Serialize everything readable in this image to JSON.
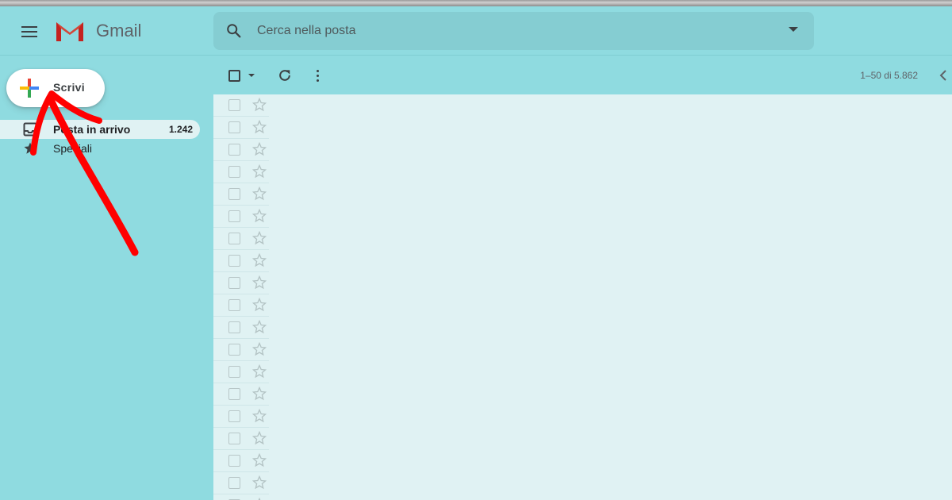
{
  "app": {
    "name": "Gmail"
  },
  "search": {
    "placeholder": "Cerca nella posta"
  },
  "compose": {
    "label": "Scrivi"
  },
  "sidebar": {
    "items": [
      {
        "label": "Posta in arrivo",
        "count": "1.242",
        "icon": "inbox-icon",
        "active": true
      },
      {
        "label": "Speciali",
        "count": "",
        "icon": "star-icon",
        "active": false
      }
    ]
  },
  "toolbar": {
    "pagination": "1–50 di 5.862"
  },
  "colors": {
    "background": "#8fdbe0",
    "list_background": "#e0f2f3",
    "annotation_arrow": "#ff0000"
  },
  "annotation": {
    "type": "hand-drawn-arrow",
    "points_to": "compose-button"
  }
}
